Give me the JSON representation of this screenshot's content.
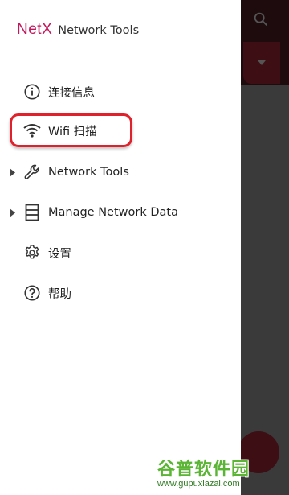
{
  "app": {
    "brand": "NetX",
    "subtitle": "Network Tools"
  },
  "menu": {
    "items": [
      {
        "label": "连接信息",
        "icon": "info-icon",
        "expandable": false
      },
      {
        "label": "Wifi 扫描",
        "icon": "wifi-icon",
        "expandable": false
      },
      {
        "label": "Network Tools",
        "icon": "wrench-icon",
        "expandable": true
      },
      {
        "label": "Manage Network Data",
        "icon": "storage-icon",
        "expandable": true
      },
      {
        "label": "设置",
        "icon": "gear-icon",
        "expandable": false
      },
      {
        "label": "帮助",
        "icon": "help-icon",
        "expandable": false
      }
    ]
  },
  "watermark": {
    "title": "谷普软件园",
    "url": "www.gupuxiazai.com"
  },
  "colors": {
    "brand": "#c2185b",
    "highlight": "#e0202a",
    "scrim": "#3a3a3a",
    "toolbar": "#1e0b0d"
  }
}
